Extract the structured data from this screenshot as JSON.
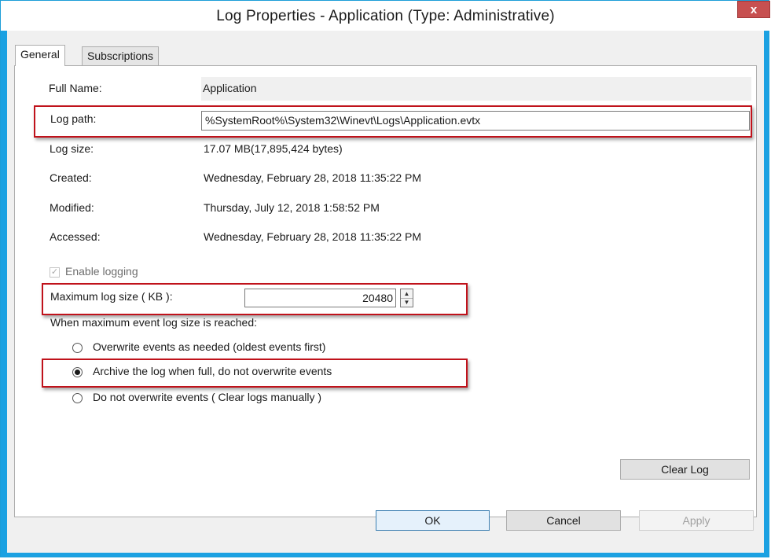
{
  "window": {
    "title": "Log Properties - Application (Type: Administrative)",
    "close_glyph": "x"
  },
  "tabs": [
    {
      "label": "General",
      "active": true
    },
    {
      "label": "Subscriptions",
      "active": false
    }
  ],
  "general": {
    "full_name_label": "Full Name:",
    "full_name_value": "Application",
    "log_path_label": "Log path:",
    "log_path_value": "%SystemRoot%\\System32\\Winevt\\Logs\\Application.evtx",
    "log_size_label": "Log size:",
    "log_size_value": "17.07 MB(17,895,424 bytes)",
    "created_label": "Created:",
    "created_value": "Wednesday, February 28, 2018 11:35:22 PM",
    "modified_label": "Modified:",
    "modified_value": "Thursday, July 12, 2018 1:58:52 PM",
    "accessed_label": "Accessed:",
    "accessed_value": "Wednesday, February 28, 2018 11:35:22 PM",
    "enable_logging_label": "Enable logging",
    "enable_logging_checked": true,
    "max_size_label": "Maximum log size ( KB ):",
    "max_size_value": "20480",
    "when_reached_label": "When maximum event log size is reached:",
    "policy_options": [
      {
        "label": "Overwrite events as needed (oldest events first)",
        "selected": false
      },
      {
        "label": "Archive the log when full, do not overwrite events",
        "selected": true
      },
      {
        "label": "Do not overwrite events ( Clear logs manually )",
        "selected": false
      }
    ],
    "clear_log_label": "Clear Log"
  },
  "footer": {
    "ok_label": "OK",
    "cancel_label": "Cancel",
    "apply_label": "Apply"
  },
  "colors": {
    "highlight": "#c0121b",
    "window_border": "#1ba1e2",
    "close_button": "#c75050"
  }
}
